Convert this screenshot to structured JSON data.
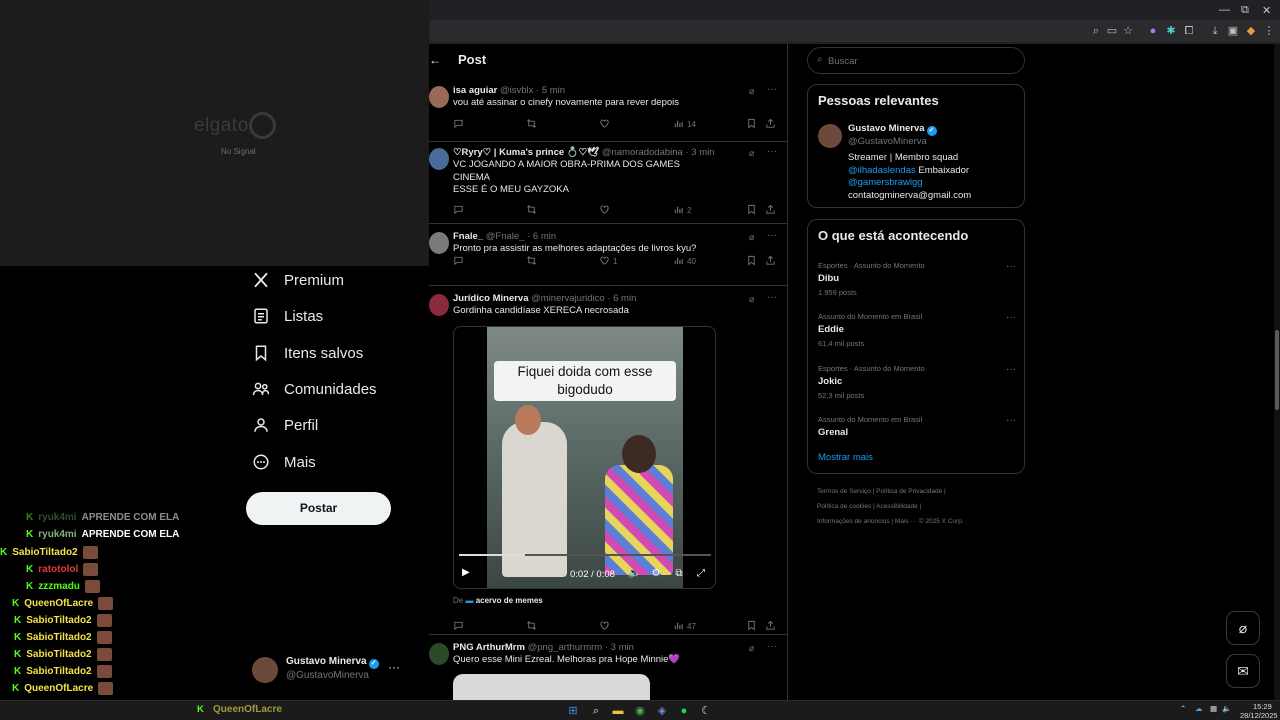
{
  "elgato": {
    "brand": "elgato",
    "status": "No Signal"
  },
  "header": {
    "back_icon": "←",
    "title": "Post"
  },
  "nav": {
    "items": [
      {
        "label": "Premium",
        "icon": "x-logo-icon"
      },
      {
        "label": "Listas",
        "icon": "list-icon"
      },
      {
        "label": "Itens salvos",
        "icon": "bookmark-icon"
      },
      {
        "label": "Comunidades",
        "icon": "people-icon"
      },
      {
        "label": "Perfil",
        "icon": "person-icon"
      },
      {
        "label": "Mais",
        "icon": "more-circle-icon"
      }
    ],
    "post_label": "Postar"
  },
  "account": {
    "name": "Gustavo Minerva",
    "handle": "@GustavoMinerva",
    "more": "···"
  },
  "chat": [
    {
      "user": "ryuk4mi",
      "msg": "APRENDE COM ELA",
      "color": "#5a8a5a",
      "dim": true
    },
    {
      "user": "ryuk4mi",
      "msg": "APRENDE COM ELA",
      "color": "#7fb37f",
      "dim": false
    },
    {
      "user": "SabioTiltado2",
      "msg": "",
      "color": "#f3e24a",
      "dim": false
    },
    {
      "user": "ratotolol",
      "msg": "",
      "color": "#e03a3a",
      "dim": false
    },
    {
      "user": "zzzmadu",
      "msg": "",
      "color": "#53fc18",
      "dim": false
    },
    {
      "user": "QueenOfLacre",
      "msg": "",
      "color": "#f3e24a",
      "dim": false
    },
    {
      "user": "SabioTiltado2",
      "msg": "",
      "color": "#f3e24a",
      "dim": false
    },
    {
      "user": "SabioTiltado2",
      "msg": "",
      "color": "#f3e24a",
      "dim": false
    },
    {
      "user": "SabioTiltado2",
      "msg": "",
      "color": "#f3e24a",
      "dim": false
    },
    {
      "user": "SabioTiltado2",
      "msg": "",
      "color": "#f3e24a",
      "dim": false
    },
    {
      "user": "QueenOfLacre",
      "msg": "",
      "color": "#f3e24a",
      "dim": false
    },
    {
      "user": "QueenOfLacre",
      "msg": "",
      "color": "#8a8a3a",
      "dim": true
    }
  ],
  "tweets": [
    {
      "name": "isa aguiar",
      "handle": "@isvblx",
      "time": "· 5 min",
      "text": "vou até assinar o cinefy novamente para rever depois",
      "likes": "",
      "views": "14"
    },
    {
      "name": "♡Ryry♡ | Kuma's prince 💍♡🕊",
      "handle": "@namoradodabina",
      "time": "· 3 min",
      "text": "VC JOGANDO A MAIOR OBRA-PRIMA DOS GAMES\nCINEMA\nESSE É O MEU GAYZOKA",
      "likes": "",
      "views": "2"
    },
    {
      "name": "Fnale_",
      "handle": "@Fnale_",
      "time": "· 6 min",
      "text": "Pronto pra assistir as melhores adaptações de livros kyu?",
      "likes": "1",
      "views": "40"
    },
    {
      "name": "Jurídico Minerva",
      "handle": "@minervajuridico",
      "time": "· 6 min",
      "text": "Gordinha candidíase XERECA necrosada",
      "likes": "",
      "views": "47"
    },
    {
      "name": "PNG ArthurMrm",
      "handle": "@png_arthurmrm",
      "time": "· 3 min",
      "text": "Quero esse Mini Ezreal. Melhoras pra Hope Minnie💜",
      "likes": "",
      "views": ""
    }
  ],
  "video": {
    "caption": "Fiquei doida com esse bigodudo",
    "time": "0:02 / 0:08",
    "progress": 0.26,
    "from_prefix": "De",
    "from_source": "acervo de memes"
  },
  "search": {
    "placeholder": "Buscar"
  },
  "relevant": {
    "title": "Pessoas relevantes",
    "name": "Gustavo Minerva",
    "handle": "@GustavoMinerva",
    "bio_line1": "Streamer | Membro squad",
    "bio_link1": "@ilhadaslendas",
    "bio_after1": " Embaixador",
    "bio_link2": "@gamersbrawlgg",
    "bio_line4": "contatogminerva@gmail.com"
  },
  "trending": {
    "title": "O que está acontecendo",
    "items": [
      {
        "category": "Esportes · Assunto do Momento",
        "topic": "Dibu",
        "count": "1.959 posts"
      },
      {
        "category": "Assunto do Momento em Brasil",
        "topic": "Eddie",
        "count": "61,4 mil posts"
      },
      {
        "category": "Esportes · Assunto do Momento",
        "topic": "Jokic",
        "count": "52,3 mil posts"
      },
      {
        "category": "Assunto do Momento em Brasil",
        "topic": "Grenal",
        "count": ""
      }
    ],
    "show_more": "Mostrar mais"
  },
  "footer": {
    "line1": "Termos de Serviço  |  Política de Privacidade  |",
    "line2": "Política de cookies  |  Acessibilidade  |",
    "line3": "Informações de anúncios  |  Mais ···  © 2025 X Corp."
  },
  "taskbar": {
    "chat_user": "QueenOfLacre",
    "time": "15:29",
    "date": "28/12/2025"
  }
}
